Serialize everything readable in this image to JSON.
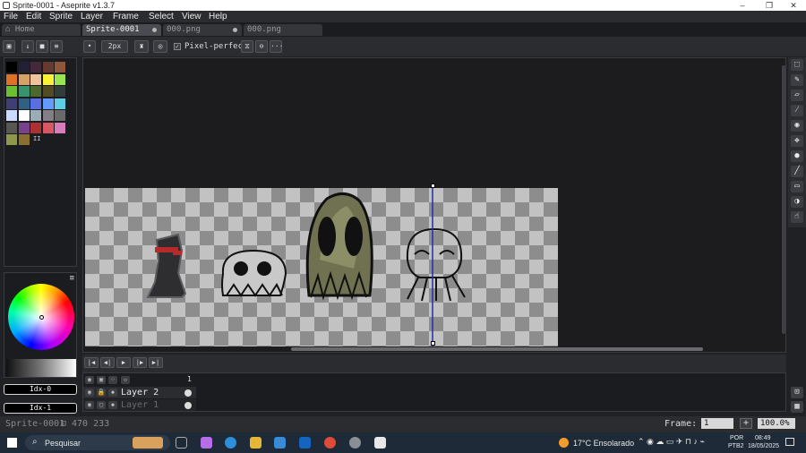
{
  "window": {
    "title": "Sprite-0001 - Aseprite v1.3.7",
    "controls": [
      "–",
      "❐",
      "✕"
    ]
  },
  "menu": [
    "File",
    "Edit",
    "Sprite",
    "Layer",
    "Frame",
    "Select",
    "View",
    "Help"
  ],
  "tabs": [
    {
      "label": "Home",
      "active": false,
      "dirty": false
    },
    {
      "label": "Sprite-0001",
      "active": true,
      "dirty": true
    },
    {
      "label": "000.png",
      "active": false,
      "dirty": true
    },
    {
      "label": "000.png",
      "active": false,
      "dirty": false
    }
  ],
  "toolbar": {
    "brush_size": "2px",
    "pixel_perfect_label": "Pixel-perfect",
    "pixel_perfect_checked": true,
    "more": "···"
  },
  "palette": {
    "colors": [
      "#000000",
      "#222034",
      "#45283c",
      "#663931",
      "#8f563b",
      "#df7126",
      "#d9a066",
      "#eec39a",
      "#fbf236",
      "#99e550",
      "#6abe30",
      "#37946e",
      "#4b692f",
      "#524b24",
      "#323c39",
      "#3f3f74",
      "#306082",
      "#5b6ee1",
      "#639bff",
      "#5fcde4",
      "#cbdbfc",
      "#ffffff",
      "#9badb7",
      "#847e87",
      "#696a6a",
      "#595652",
      "#76428a",
      "#ac3232",
      "#d95763",
      "#d77bba",
      "#8f974a",
      "#8a6f30"
    ],
    "more_label": "II"
  },
  "colors": {
    "foreground": "Idx-0",
    "background": "Idx-1"
  },
  "tools": [
    "marquee-tool",
    "pencil-tool",
    "eraser-tool",
    "eyedropper-tool",
    "zoom-tool",
    "move-tool",
    "fill-tool",
    "line-tool",
    "rectangle-tool",
    "blur-tool",
    "smudge-tool"
  ],
  "timeline": {
    "playback": [
      "first-frame",
      "previous-frame",
      "play",
      "next-frame",
      "last-frame"
    ],
    "frame_header": "1",
    "layers": [
      {
        "name": "Layer 2",
        "visible": true,
        "locked": true
      },
      {
        "name": "Layer 1",
        "visible": true,
        "locked": false
      }
    ]
  },
  "status": {
    "sprite_name": "Sprite-0001",
    "coords": "470 233",
    "frame_label": "Frame:",
    "frame_value": "1",
    "add_frame": "+",
    "zoom": "100.0%"
  },
  "taskbar": {
    "search_placeholder": "Pesquisar",
    "weather": "17°C  Ensolarado",
    "lang_top": "POR",
    "lang_bottom": "PTB2",
    "time": "08:49",
    "date": "18/05/2025"
  }
}
